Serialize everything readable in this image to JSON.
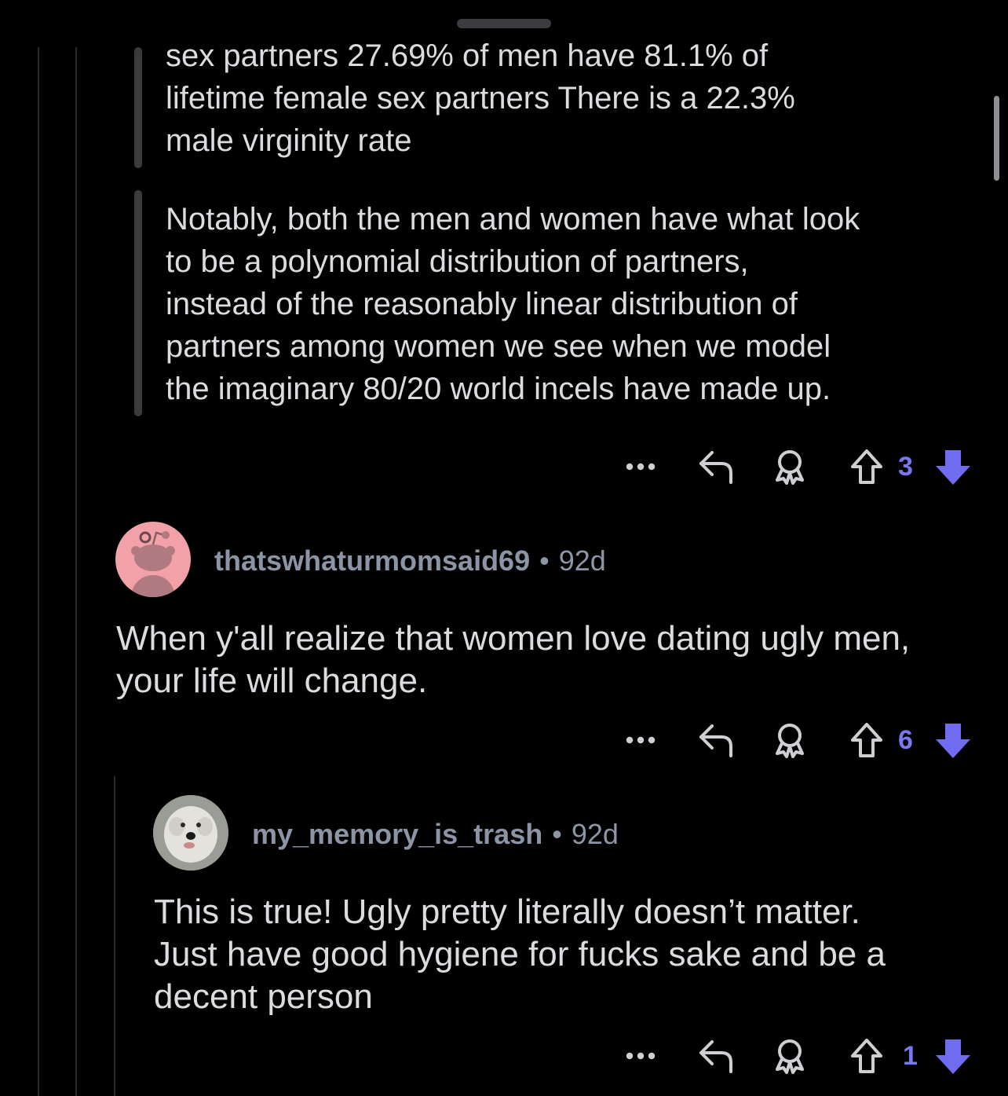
{
  "theme": {
    "background": "#000000",
    "text": "#dcdce0",
    "muted": "#8d96a6",
    "vote_accent": "#7a78ee"
  },
  "quotes": [
    {
      "lines": [
        "sex partners 27.69% of men have 81.1% of",
        "lifetime female sex partners There is a 22.3%",
        "male virginity rate"
      ]
    },
    {
      "lines": [
        "Notably, both the men and women have what look",
        "to be a polynomial distribution of partners,",
        "instead of the reasonably linear distribution of",
        "partners among women we see when we model",
        "the imaginary 80/20 world incels have made up."
      ]
    }
  ],
  "actions": {
    "more_icon": "more-icon",
    "reply_icon": "reply-icon",
    "award_icon": "award-icon",
    "upvote_icon": "upvote-icon",
    "downvote_icon": "downvote-icon"
  },
  "comments": [
    {
      "id": "parent",
      "score": "3"
    },
    {
      "id": "c1",
      "username": "thatswhaturmomsaid69",
      "separator": "•",
      "age": "92d",
      "avatar_icon": "snoo-avatar",
      "lines": [
        "When y'all realize that women love dating ugly men,",
        "your life will change."
      ],
      "score": "6"
    },
    {
      "id": "c2",
      "username": "my_memory_is_trash",
      "separator": "•",
      "age": "92d",
      "avatar_icon": "dog-photo-avatar",
      "lines": [
        "This is true! Ugly pretty literally doesn’t matter.",
        "Just have good hygiene for fucks sake and be a",
        "decent person"
      ],
      "score": "1"
    }
  ]
}
